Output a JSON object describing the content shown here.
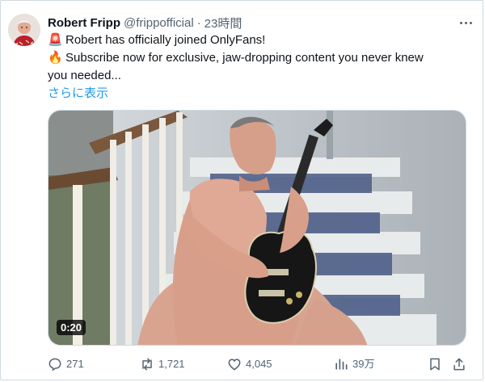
{
  "tweet": {
    "author_name": "Robert Fripp",
    "author_handle": "@frippofficial",
    "separator": "·",
    "time": "23時間",
    "line1": "Robert has officially joined OnlyFans!",
    "line2": "Subscribe now for exclusive, jaw-dropping content you never knew",
    "line3": "you needed...",
    "emoji1": "🚨",
    "emoji2": "🔥",
    "show_more": "さらに表示",
    "video_duration": "0:20"
  },
  "actions": {
    "replies": "271",
    "reposts": "1,721",
    "likes": "4,045",
    "views": "39万"
  },
  "icons": {
    "more": "more-icon",
    "reply": "reply-icon",
    "repost": "repost-icon",
    "like": "like-icon",
    "views": "views-icon",
    "bookmark": "bookmark-icon",
    "share": "share-icon"
  },
  "colors": {
    "text": "#0f1419",
    "secondary": "#536471",
    "link": "#1d9bf0",
    "border": "#cfd9de"
  }
}
